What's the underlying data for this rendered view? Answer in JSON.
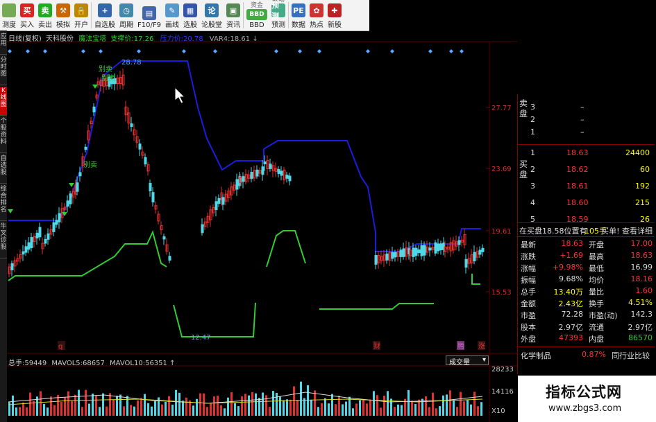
{
  "toolbar": [
    {
      "label": "测度",
      "icon": "stethoscope-icon",
      "color": "#7a5"
    },
    {
      "label": "买入",
      "icon": "buy-icon",
      "glyph": "买",
      "color": "#d22"
    },
    {
      "label": "卖出",
      "icon": "sell-icon",
      "glyph": "卖",
      "color": "#2a2"
    },
    {
      "label": "模拟",
      "icon": "hammer-icon",
      "glyph": "⚒",
      "color": "#c60"
    },
    {
      "label": "开户",
      "icon": "lock-icon",
      "glyph": "🔒",
      "color": "#b80"
    },
    {
      "label": "自选股",
      "icon": "watchlist-icon",
      "glyph": "+",
      "color": "#36a"
    },
    {
      "label": "周期",
      "icon": "clock-icon",
      "glyph": "◷",
      "color": "#48a"
    },
    {
      "label": "F10/F9",
      "icon": "info-icon",
      "glyph": "▤",
      "color": "#46a"
    },
    {
      "label": "画线",
      "icon": "pen-icon",
      "glyph": "✎",
      "color": "#59c"
    },
    {
      "label": "选股",
      "icon": "select-stock-icon",
      "glyph": "▦",
      "color": "#35a"
    },
    {
      "label": "论股堂",
      "icon": "forum-icon",
      "glyph": "论",
      "color": "#37a"
    },
    {
      "label": "资讯",
      "icon": "news-icon",
      "glyph": "▣",
      "color": "#585"
    },
    {
      "label": "BBD",
      "top": "资金",
      "icon": "bbd-icon",
      "glyph": "BBD",
      "color": "#4a4"
    },
    {
      "label": "预测",
      "top": "联动",
      "icon": "forecast-icon",
      "glyph": "预测",
      "color": "#4a8"
    },
    {
      "label": "数据",
      "icon": "pe-icon",
      "glyph": "PE",
      "color": "#3770c0"
    },
    {
      "label": "热点",
      "icon": "hot-icon",
      "glyph": "✿",
      "color": "#c33"
    },
    {
      "label": "新股",
      "icon": "new-stock-icon",
      "glyph": "✚",
      "color": "#b22"
    }
  ],
  "side_tabs": [
    {
      "label": "应用",
      "active": false
    },
    {
      "label": "分时图",
      "active": false
    },
    {
      "label": "K线图",
      "active": true
    },
    {
      "label": "个股资料",
      "active": false
    },
    {
      "label": "自选股",
      "active": false
    },
    {
      "label": "综合排名",
      "active": false
    },
    {
      "label": "牛叉诊股",
      "active": false
    }
  ],
  "chart_header": {
    "period": "日线(复权)",
    "stock": "天科股份",
    "indicator": "魔法宝塔",
    "support_label": "支撑价:",
    "support_value": "17.26",
    "pressure_label": "压力价:",
    "pressure_value": "20.78",
    "var_label": "VAR4:",
    "var_value": "18.61"
  },
  "price_axis": [
    "27.77",
    "23.69",
    "19.61",
    "15.53"
  ],
  "chart_annotations": {
    "high": "28.78",
    "low": "12.47",
    "sell1": "别卖",
    "sell2": "别卖",
    "sell3": "别卖"
  },
  "event_markers": [
    {
      "label": "q",
      "color": "#d33"
    },
    {
      "label": "财",
      "color": "#d33"
    },
    {
      "label": "腾",
      "color": "#c6c"
    },
    {
      "label": "涨",
      "color": "#d33"
    }
  ],
  "volume_header": {
    "total_label": "总手:",
    "total_value": "59449",
    "ma5_label": "MAVOL5:",
    "ma5_value": "68657",
    "ma10_label": "MAVOL10:",
    "ma10_value": "56351",
    "select_value": "成交量"
  },
  "volume_axis": [
    "28233",
    "14116",
    "X10"
  ],
  "order_book": {
    "sell_label": "卖盘",
    "buy_label": "买盘",
    "sell": [
      {
        "level": "3",
        "price": "–",
        "volume": ""
      },
      {
        "level": "2",
        "price": "–",
        "volume": ""
      },
      {
        "level": "1",
        "price": "–",
        "volume": ""
      }
    ],
    "buy": [
      {
        "level": "1",
        "price": "18.63",
        "volume": "24400"
      },
      {
        "level": "2",
        "price": "18.62",
        "volume": "60"
      },
      {
        "level": "3",
        "price": "18.61",
        "volume": "192"
      },
      {
        "level": "4",
        "price": "18.60",
        "volume": "215"
      },
      {
        "level": "5",
        "price": "18.59",
        "volume": "26"
      }
    ],
    "notice": "在买盘18.58位置有",
    "notice_volume": "105手",
    "notice_link": "买单! 查看详细"
  },
  "stats": [
    {
      "l1": "最新",
      "v1": "18.63",
      "l2": "开盘",
      "v2": "17.00",
      "c1": "#f33",
      "c2": "#f33"
    },
    {
      "l1": "涨跌",
      "v1": "+1.69",
      "l2": "最高",
      "v2": "18.63",
      "c1": "#f33",
      "c2": "#f33"
    },
    {
      "l1": "涨幅",
      "v1": "+9.98%",
      "l2": "最低",
      "v2": "16.99",
      "c1": "#f33",
      "c2": "#ddd"
    },
    {
      "l1": "振幅",
      "v1": "9.68%",
      "l2": "均价",
      "v2": "18.16",
      "c1": "#ddd",
      "c2": "#f33"
    },
    {
      "l1": "总手",
      "v1": "13.40万",
      "l2": "量比",
      "v2": "1.60",
      "c1": "#ff0",
      "c2": "#f33"
    },
    {
      "l1": "金额",
      "v1": "2.43亿",
      "l2": "换手",
      "v2": "4.51%",
      "c1": "#ff0",
      "c2": "#ff0"
    },
    {
      "l1": "市盈",
      "v1": "72.28",
      "l2": "市盈(动)",
      "v2": "142.3",
      "c1": "#ddd",
      "c2": "#ddd"
    },
    {
      "l1": "股本",
      "v1": "2.97亿",
      "l2": "流通",
      "v2": "2.97亿",
      "c1": "#ddd",
      "c2": "#ddd"
    },
    {
      "l1": "外盘",
      "v1": "47393",
      "l2": "内盘",
      "v2": "86570",
      "c1": "#f33",
      "c2": "#3c3"
    }
  ],
  "sector": {
    "name": "化学制品",
    "change": "0.87%",
    "link": "同行业比较"
  },
  "watermark": {
    "title": "指标公式网",
    "url": "www.zbgs3.com"
  }
}
